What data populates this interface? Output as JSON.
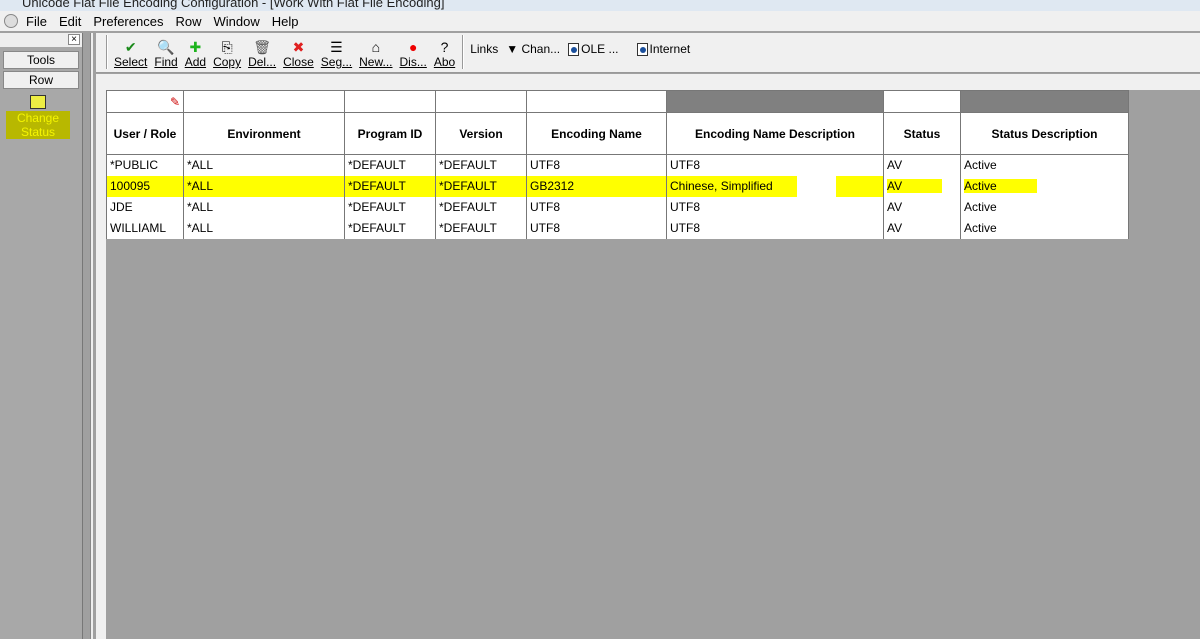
{
  "window": {
    "title": "Unicode Flat File Encoding Configuration - [Work With Flat File Encoding]"
  },
  "menu": [
    "File",
    "Edit",
    "Preferences",
    "Row",
    "Window",
    "Help"
  ],
  "left_panel": {
    "tools": "Tools",
    "row": "Row",
    "change_status": "Change Status"
  },
  "toolbar": {
    "buttons": [
      {
        "label": "Select",
        "icon": "✔",
        "color": "#1a8a1a"
      },
      {
        "label": "Find",
        "icon": "🔍",
        "color": "#000"
      },
      {
        "label": "Add",
        "icon": "✚",
        "color": "#1db31d"
      },
      {
        "label": "Copy",
        "icon": "⎘",
        "color": "#000"
      },
      {
        "label": "Del...",
        "icon": "🗑",
        "color": "#555"
      },
      {
        "label": "Close",
        "icon": "✖",
        "color": "#e02020"
      },
      {
        "label": "Seg...",
        "icon": "☰",
        "color": "#000"
      },
      {
        "label": "New...",
        "icon": "⌂",
        "color": "#000"
      },
      {
        "label": "Dis...",
        "icon": "●",
        "color": "#e00"
      },
      {
        "label": "Abo",
        "icon": "?",
        "color": "#000"
      }
    ],
    "links_label": "Links",
    "chan": "Chan...",
    "ole": "OLE ...",
    "internet": "Internet"
  },
  "grid": {
    "columns": [
      "User / Role",
      "Environment",
      "Program ID",
      "Version",
      "Encoding Name",
      "Encoding Name Description",
      "Status",
      "Status Description"
    ],
    "rows": [
      [
        "*PUBLIC",
        "*ALL",
        "*DEFAULT",
        "*DEFAULT",
        "UTF8",
        "UTF8",
        "AV",
        "Active"
      ],
      [
        "100095",
        "*ALL",
        "*DEFAULT",
        "*DEFAULT",
        "GB2312",
        "Chinese, Simplified",
        "AV",
        "Active"
      ],
      [
        "JDE",
        "*ALL",
        "*DEFAULT",
        "*DEFAULT",
        "UTF8",
        "UTF8",
        "AV",
        "Active"
      ],
      [
        "WILLIAML",
        "*ALL",
        "*DEFAULT",
        "*DEFAULT",
        "UTF8",
        "UTF8",
        "AV",
        "Active"
      ]
    ],
    "highlighted_row": 1,
    "highlight_color": "#ffff00"
  }
}
